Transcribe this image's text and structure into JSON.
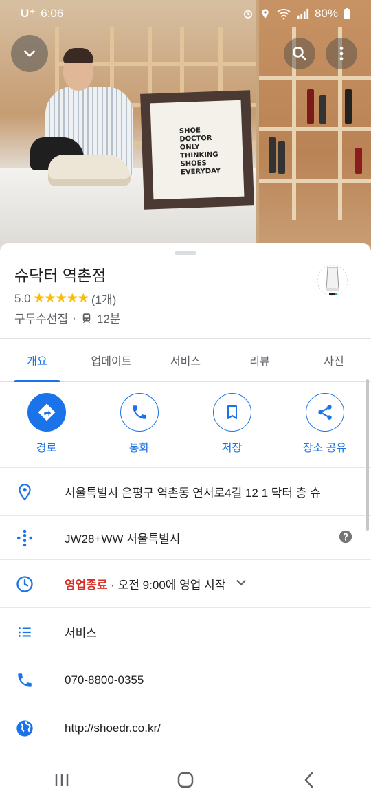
{
  "status_bar": {
    "carrier": "U⁺",
    "time": "6:06",
    "battery": "80%"
  },
  "place": {
    "name": "슈닥터 역촌점",
    "rating": "5.0",
    "review_count": "(1개)",
    "category": "구두수선집",
    "separator": "·",
    "transit_time": "12분"
  },
  "tabs": [
    {
      "label": "개요",
      "active": true
    },
    {
      "label": "업데이트",
      "active": false
    },
    {
      "label": "서비스",
      "active": false
    },
    {
      "label": "리뷰",
      "active": false
    },
    {
      "label": "사진",
      "active": false
    }
  ],
  "actions": [
    {
      "label": "경로",
      "icon": "directions-icon"
    },
    {
      "label": "통화",
      "icon": "phone-icon"
    },
    {
      "label": "저장",
      "icon": "bookmark-icon"
    },
    {
      "label": "장소 공유",
      "icon": "share-icon"
    }
  ],
  "info": {
    "address": "서울특별시 은평구 역촌동 연서로4길 12 1 닥터 층 슈",
    "plus_code": "JW28+WW 서울특별시",
    "hours_status": "영업종료",
    "hours_detail": "· 오전 9:00에 영업 시작",
    "services": "서비스",
    "phone": "070-8800-0355",
    "website": "http://shoedr.co.kr/"
  },
  "photo_sign": "SHOE\nDOCTOR\nONLY\nTHINKING\nSHOES\nEVERYDAY",
  "colors": {
    "accent": "#1a73e8",
    "star": "#fbbc04",
    "closed": "#d93025",
    "text": "#202124",
    "secondary": "#5f6368"
  }
}
